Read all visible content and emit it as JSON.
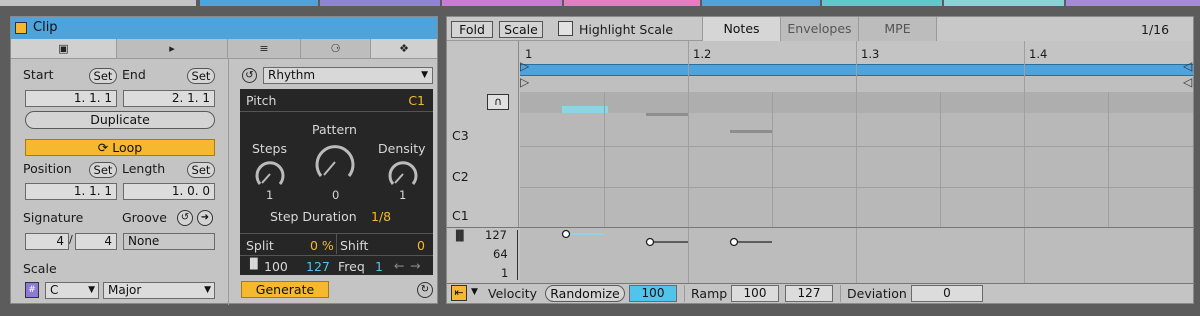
{
  "colors": {
    "clip_blue": "#4ea3dd",
    "loop_orange": "#f5b82e",
    "value_blue": "#50c4ea",
    "strip_colors": [
      "#c4c4c4",
      "#4ea3dd",
      "#8f83d4",
      "#c87ed0",
      "#e47ec0",
      "#4ea3dd",
      "#5fc9c9",
      "#88d3d6",
      "#a48ad8"
    ]
  },
  "clip": {
    "title": "Clip",
    "tabs": [
      "play-square-icon",
      "play-flag-icon",
      "sliders-icon",
      "dice-icon",
      "pattern-icon"
    ],
    "start_label": "Start",
    "end_label": "End",
    "set_label": "Set",
    "start_value": "1.   1.   1",
    "end_value": "2.   1.   1",
    "duplicate_label": "Duplicate",
    "loop_label": "Loop",
    "position_label": "Position",
    "length_label": "Length",
    "position_value": "1.   1.   1",
    "length_value": "1.   0.   0",
    "signature_label": "Signature",
    "groove_label": "Groove",
    "sig_num": "4",
    "sig_den": "4",
    "groove_value": "None",
    "scale_label": "Scale",
    "scale_root": "C",
    "scale_mode": "Major"
  },
  "generator": {
    "mode": "Rhythm",
    "pitch_label": "Pitch",
    "pitch_value": "C1",
    "pattern_label": "Pattern",
    "steps_label": "Steps",
    "density_label": "Density",
    "steps_value": "1",
    "pattern_value": "0",
    "density_value": "1",
    "step_duration_label": "Step Duration",
    "step_duration_value": "1/8",
    "split_label": "Split",
    "split_value": "0 %",
    "shift_label": "Shift",
    "shift_value": "0",
    "vel_value": "100",
    "vel_value2": "127",
    "freq_label": "Freq",
    "freq_value": "1",
    "generate_label": "Generate"
  },
  "editor": {
    "fold_label": "Fold",
    "scale_label": "Scale",
    "highlight_label": "Highlight Scale",
    "tabs": [
      "Notes",
      "Envelopes",
      "MPE"
    ],
    "grid": "1/16",
    "bars": [
      "1",
      "1.2",
      "1.3",
      "1.4"
    ],
    "pitch_rows": [
      "C3",
      "C2",
      "C1"
    ],
    "velocity_ticks": [
      "127",
      "64",
      "1"
    ],
    "velocity_label": "Velocity",
    "randomize_label": "Randomize",
    "velocity_value": "100",
    "ramp_label": "Ramp",
    "ramp_from": "100",
    "ramp_to": "127",
    "deviation_label": "Deviation",
    "deviation_value": "0"
  }
}
